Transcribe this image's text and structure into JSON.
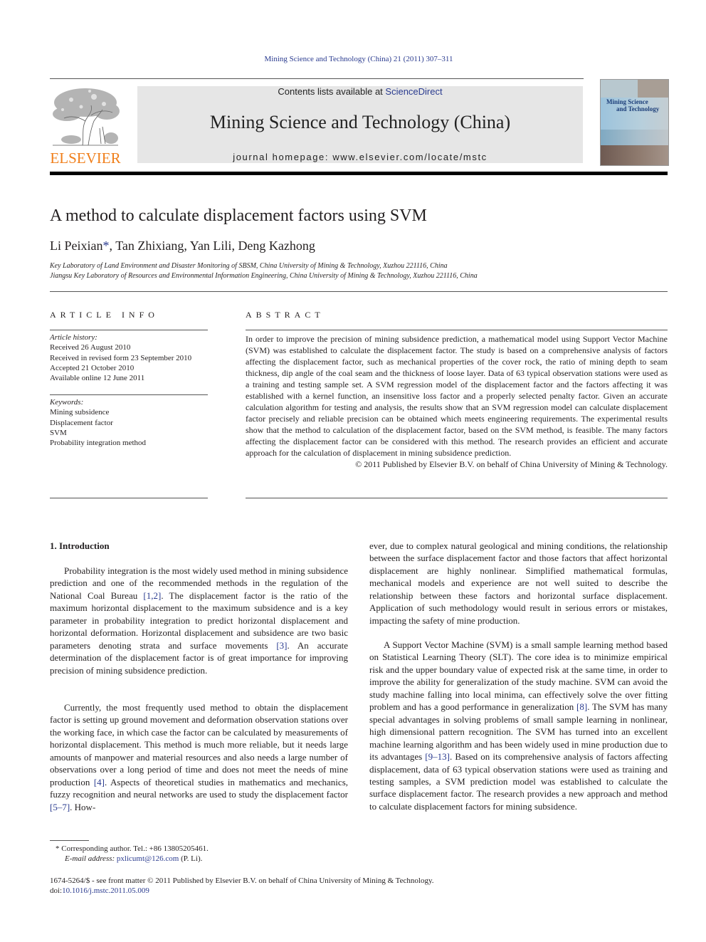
{
  "running_head": "Mining Science and Technology (China) 21 (2011) 307–311",
  "masthead": {
    "publisher_wordmark": "ELSEVIER",
    "contents_prefix": "Contents lists available at ",
    "contents_link": "ScienceDirect",
    "journal_title": "Mining Science and Technology (China)",
    "homepage_prefix": "journal homepage: ",
    "homepage_url": "www.elsevier.com/locate/mstc",
    "cover": {
      "title_line1": "Mining Science",
      "title_line2": "and Technology"
    },
    "colors": {
      "elsevier_orange": "#f07f1b",
      "link_blue": "#2a3b8f",
      "masthead_gray": "#e6e6e6"
    }
  },
  "article": {
    "title": "A method to calculate displacement factors using SVM",
    "authors": [
      {
        "name": "Li Peixian",
        "mark": "*"
      },
      {
        "name": "Tan Zhixiang"
      },
      {
        "name": "Yan Lili"
      },
      {
        "name": "Deng Kazhong"
      }
    ],
    "author_sep": ", ",
    "affiliations": [
      "Key Laboratory of Land Environment and Disaster Monitoring of SBSM, China University of Mining & Technology, Xuzhou 221116, China",
      "Jiangsu Key Laboratory of Resources and Environmental Information Engineering, China University of Mining & Technology, Xuzhou 221116, China"
    ]
  },
  "article_info": {
    "heading": "ARTICLE INFO",
    "history_label": "Article history:",
    "history": [
      "Received 26 August 2010",
      "Received in revised form 23 September 2010",
      "Accepted 21 October 2010",
      "Available online 12 June 2011"
    ],
    "keywords_label": "Keywords:",
    "keywords": [
      "Mining subsidence",
      "Displacement factor",
      "SVM",
      "Probability integration method"
    ]
  },
  "abstract": {
    "heading": "ABSTRACT",
    "text": "In order to improve the precision of mining subsidence prediction, a mathematical model using Support Vector Machine (SVM) was established to calculate the displacement factor. The study is based on a comprehensive analysis of factors affecting the displacement factor, such as mechanical properties of the cover rock, the ratio of mining depth to seam thickness, dip angle of the coal seam and the thickness of loose layer. Data of 63 typical observation stations were used as a training and testing sample set. A SVM regression model of the displacement factor and the factors affecting it was established with a kernel function, an insensitive loss factor and a properly selected penalty factor. Given an accurate calculation algorithm for testing and analysis, the results show that an SVM regression model can calcu­late displacement factor precisely and reliable precision can be obtained which meets engineering requirements. The experimental results show that the method to calculation of the displacement factor, based on the SVM method, is feasible. The many factors affecting the displacement factor can be consid­ered with this method. The research provides an efficient and accurate approach for the calculation of displacement in mining subsidence prediction.",
    "copyright": "© 2011 Published by Elsevier B.V. on behalf of China University of Mining & Technology."
  },
  "introduction": {
    "heading": "1. Introduction",
    "p1": {
      "a": "Probability integration is the most widely used method in mining subsidence prediction and one of the recommended methods in the regulation of the National Coal Bureau ",
      "ref1": "[1,2]",
      "b": ". The displacement factor is the ratio of the maximum horizontal displacement to the maximum subsidence and is a key parameter in probability integration to predict horizontal displacement and horizontal deformation. Horizontal displacement and subsidence are two basic parameters denoting strata and surface movements ",
      "ref2": "[3]",
      "c": ". An accurate determination of the displacement factor is of great importance for improving precision of mining subsidence prediction."
    },
    "p2": {
      "a": "Currently, the most frequently used method to obtain the displacement factor is setting up ground movement and deformation observation stations over the working face, in which case the factor can be calculated by measurements of horizontal displacement. This method is much more reliable, but it needs large amounts of manpower and material resources and also needs a large number of observations over a long period of time and does not meet the needs of mine production ",
      "ref1": "[4]",
      "b": ". Aspects of theoretical studies in mathematics and mechanics, fuzzy recognition and neural networks are used to study the displacement factor ",
      "ref2": "[5–7]",
      "c": ". How-"
    },
    "p2_cont": "ever, due to complex natural geological and mining conditions, the relationship between the surface displacement factor and those factors that affect horizontal displacement are highly nonlin­ear. Simplified mathematical formulas, mechanical models and experience are not well suited to describe the relationship between these factors and horizontal surface displacement. Application of such methodology would result in serious errors or mistakes, impacting the safety of mine production.",
    "p3": {
      "a": "A Support Vector Machine (SVM) is a small sample learning method based on Statistical Learning Theory (SLT). The core idea is to minimize empirical risk and the upper boundary value of expected risk at the same time, in order to improve the ability for generalization of the study machine. SVM can avoid the study machine falling into local minima, can effectively solve the over fitting problem and has a good performance in generalization ",
      "ref1": "[8]",
      "b": ". The SVM has many special advantages in solving problems of small sample learning in nonlinear, high dimensional pattern recognition. The SVM has turned into an excellent machine learning algorithm and has been widely used in mine production due to its advantages ",
      "ref2": "[9–13]",
      "c": ". Based on its comprehensive analysis of factors affecting displacement, data of 63 typical observation stations were used as training and testing samples, a SVM prediction model was established to calculate the surface displacement factor. The research provides a new approach and method to calculate displacement factors for mining subsidence."
    }
  },
  "footnotes": {
    "corresponding": "* Corresponding author. Tel.: +86 13805205461.",
    "email_label": "E-mail address: ",
    "email": "pxlicumt@126.com",
    "email_suffix": " (P. Li)."
  },
  "bottom": {
    "issn_line": "1674-5264/$ - see front matter © 2011 Published by Elsevier B.V. on behalf of China University of Mining & Technology.",
    "doi_label": "doi:",
    "doi": "10.1016/j.mstc.2011.05.009"
  }
}
